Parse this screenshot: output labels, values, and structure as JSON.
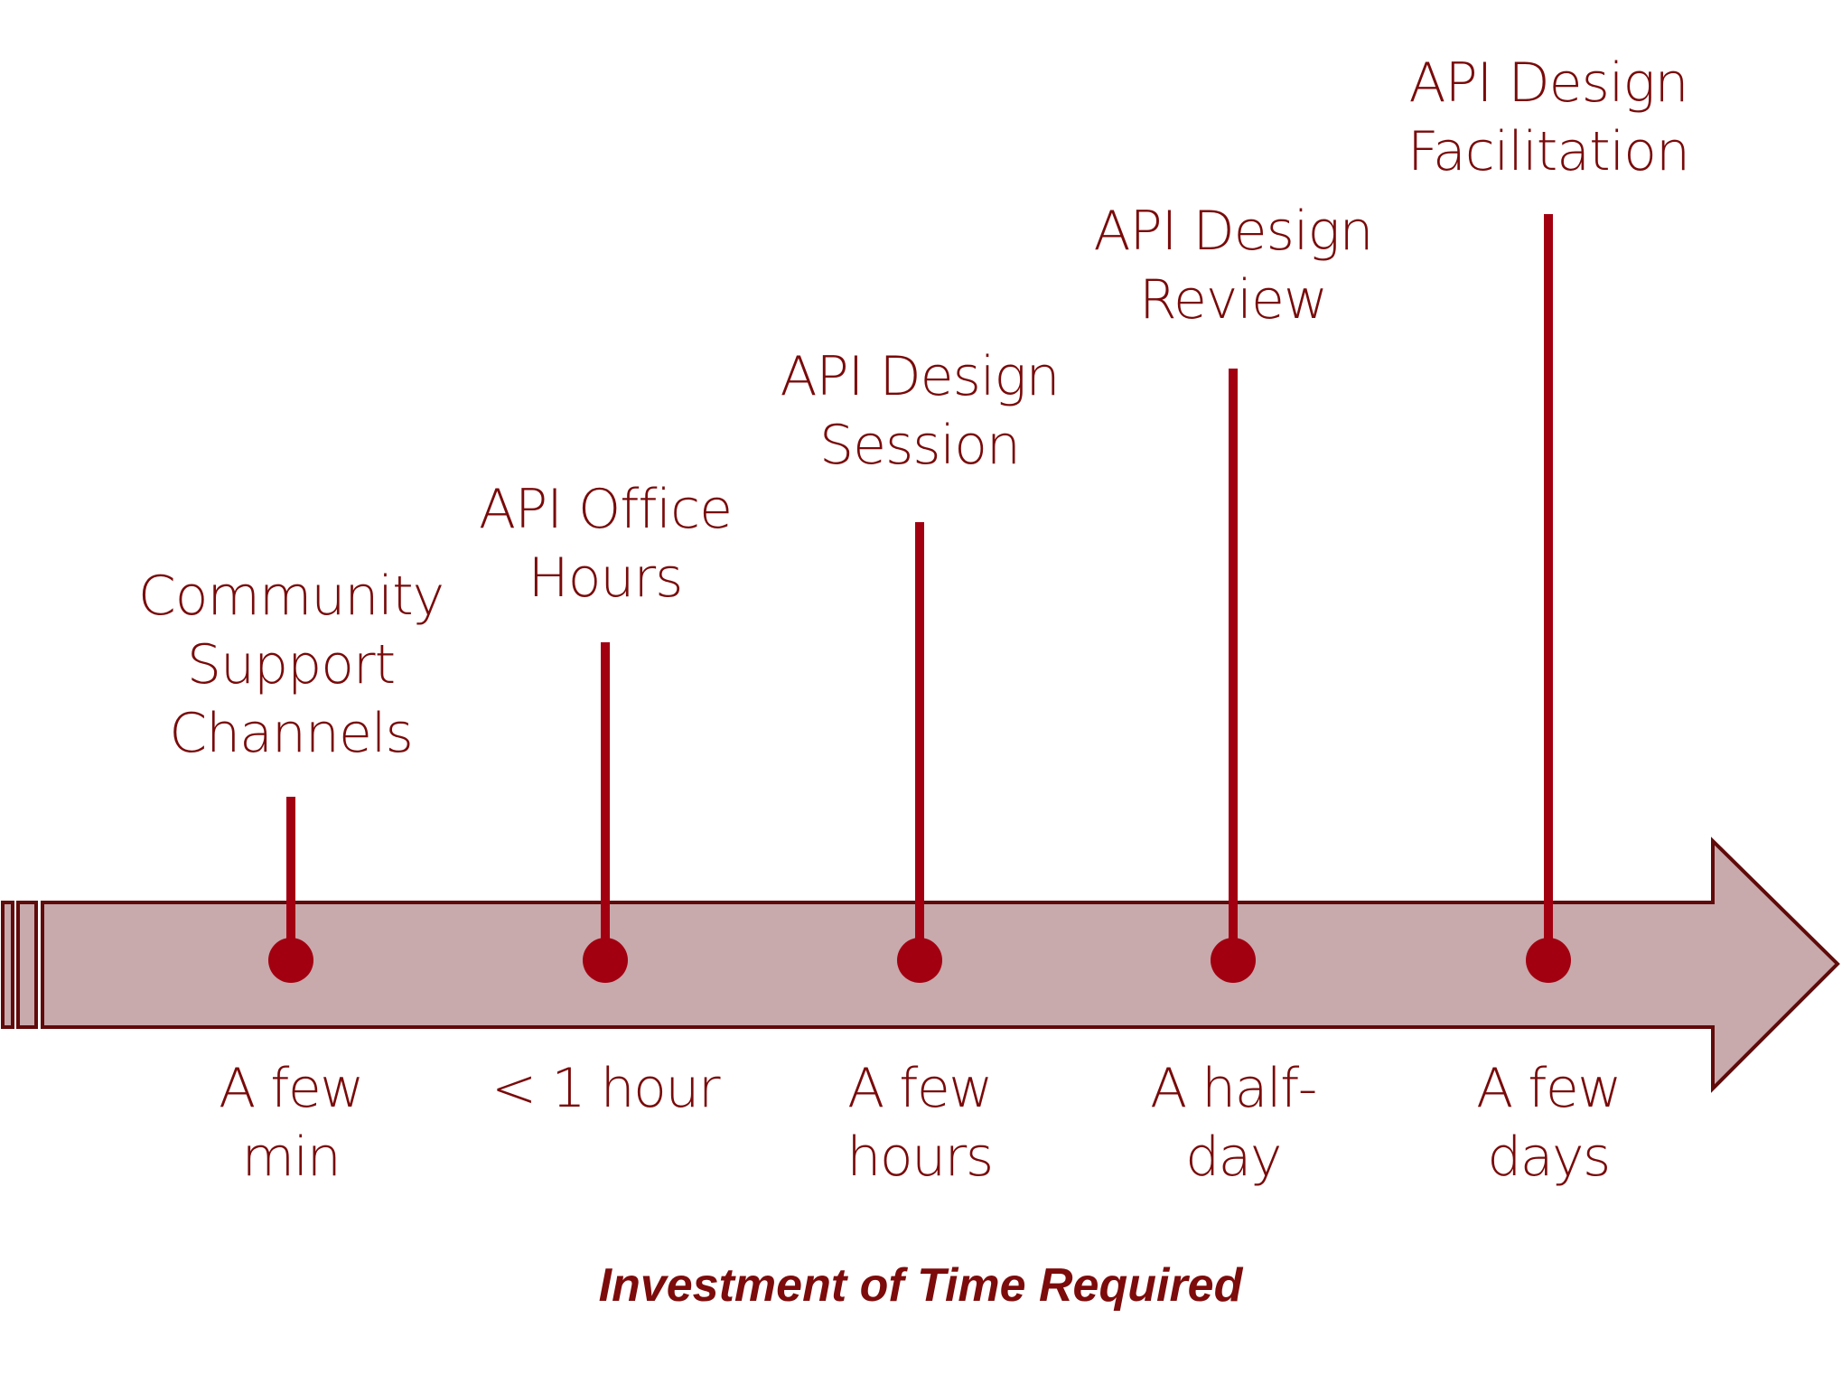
{
  "diagram": {
    "type": "timeline",
    "axis_title": "Investment of Time Required",
    "colors": {
      "arrow_fill": "#c8a9ac",
      "arrow_stroke": "#600a0a",
      "marker": "#a20010",
      "text": "#7a0a0a"
    },
    "milestones": [
      {
        "label_lines": [
          "Community",
          "Support",
          "Channels"
        ],
        "time_lines": [
          "A few",
          "min"
        ],
        "rank": 1
      },
      {
        "label_lines": [
          "API Office",
          "Hours"
        ],
        "time_lines": [
          "< 1 hour"
        ],
        "rank": 2
      },
      {
        "label_lines": [
          "API Design",
          "Session"
        ],
        "time_lines": [
          "A few",
          "hours"
        ],
        "rank": 3
      },
      {
        "label_lines": [
          "API Design",
          "Review"
        ],
        "time_lines": [
          "A half-",
          "day"
        ],
        "rank": 4
      },
      {
        "label_lines": [
          "API Design",
          "Facilitation"
        ],
        "time_lines": [
          "A few",
          "days"
        ],
        "rank": 5
      }
    ]
  }
}
